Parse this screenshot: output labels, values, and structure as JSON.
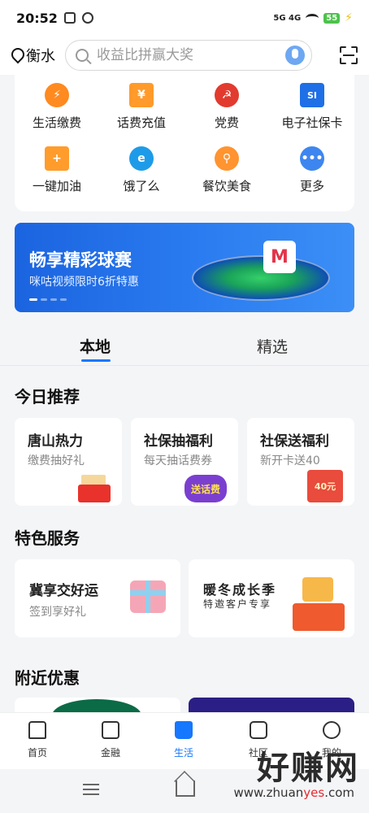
{
  "status_bar": {
    "time": "20:52",
    "network": "5G 4G",
    "battery": "55"
  },
  "header": {
    "location": "衡水",
    "search_placeholder": "收益比拼赢大奖"
  },
  "services": [
    {
      "label": "生活缴费",
      "icon": "lightning-icon",
      "color": "#ff8a1f"
    },
    {
      "label": "话费充值",
      "icon": "phone-bill-icon",
      "color": "#ff9a2b"
    },
    {
      "label": "党费",
      "icon": "party-emblem-icon",
      "color": "#e23a2e"
    },
    {
      "label": "电子社保卡",
      "icon": "si-card-icon",
      "color": "#1f6fe6"
    },
    {
      "label": "一键加油",
      "icon": "fuel-icon",
      "color": "#ff9c2b"
    },
    {
      "label": "饿了么",
      "icon": "eleme-icon",
      "color": "#1e9be8"
    },
    {
      "label": "餐饮美食",
      "icon": "dining-icon",
      "color": "#ff9430"
    },
    {
      "label": "更多",
      "icon": "more-icon",
      "color": "#3e86ef"
    }
  ],
  "banner": {
    "title": "畅享精彩球赛",
    "subtitle": "咪咕视频限时6折特惠",
    "logo_letter": "M"
  },
  "tabs": [
    {
      "label": "本地"
    },
    {
      "label": "精选"
    }
  ],
  "sections": {
    "today": "今日推荐",
    "featured": "特色服务",
    "nearby": "附近优惠"
  },
  "recommend": [
    {
      "title": "唐山热力",
      "sub": "缴费抽好礼",
      "art": "red-envelope-icon"
    },
    {
      "title": "社保抽福利",
      "sub": "每天抽话费券",
      "art_text": "送话费"
    },
    {
      "title": "社保送福利",
      "sub": "新开卡送40",
      "art_text": "40元"
    }
  ],
  "featured": [
    {
      "title": "冀享交好运",
      "sub": "签到享好礼",
      "art": "gift-box-icon"
    },
    {
      "title": "暖冬成长季",
      "sub": "特邀客户专享",
      "art": "gift-pile-icon"
    }
  ],
  "bottom_nav": [
    {
      "label": "首页",
      "icon": "home-icon"
    },
    {
      "label": "金融",
      "icon": "finance-icon"
    },
    {
      "label": "生活",
      "icon": "shopping-bag-icon"
    },
    {
      "label": "社区",
      "icon": "chat-icon"
    },
    {
      "label": "我的",
      "icon": "profile-icon"
    }
  ],
  "watermark": {
    "big": "好赚网",
    "url_pre": "www.zhuan",
    "url_hl": "yes",
    "url_post": ".com"
  },
  "colors": {
    "accent": "#1677ff",
    "banner": "#2b7cf0"
  }
}
